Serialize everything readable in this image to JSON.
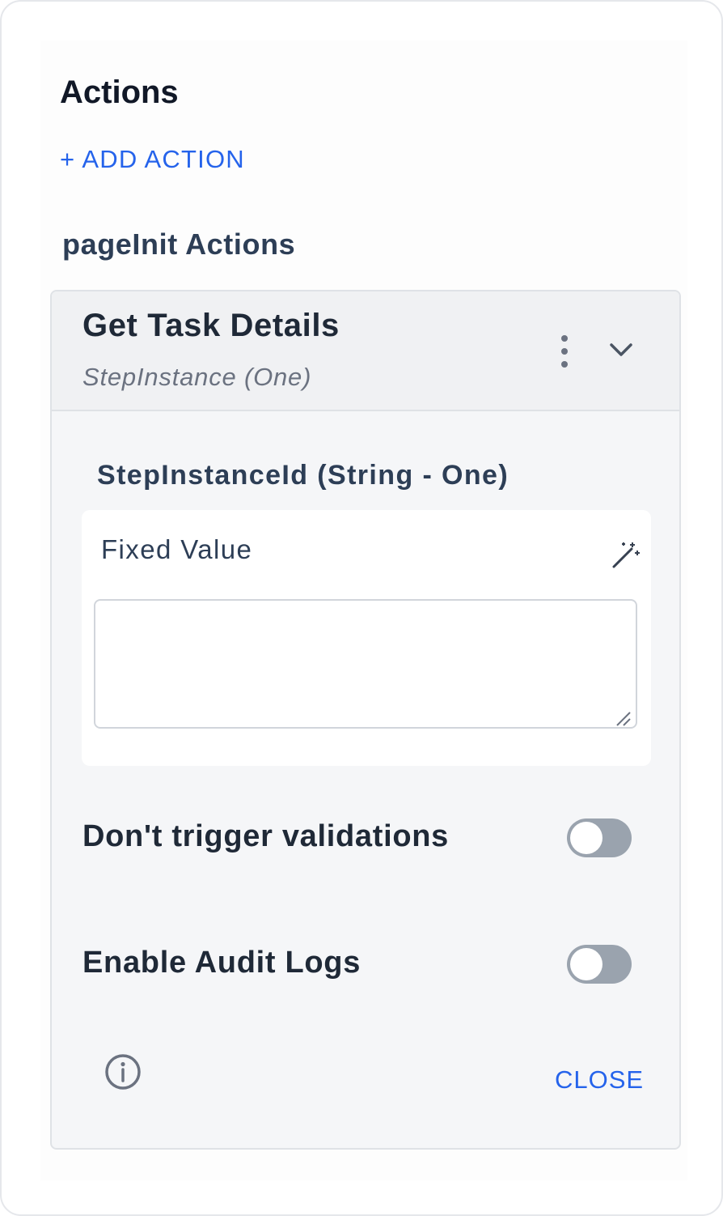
{
  "actions_panel": {
    "title": "Actions",
    "add_action_label": "+ ADD ACTION",
    "group_title": "pageInit Actions"
  },
  "action_card": {
    "title": "Get Task Details",
    "subtitle": "StepInstance (One)",
    "parameter": {
      "label": "StepInstanceId (String - One)",
      "value_mode_label": "Fixed Value",
      "value": ""
    },
    "toggles": [
      {
        "label": "Don't trigger validations",
        "enabled": false
      },
      {
        "label": "Enable Audit Logs",
        "enabled": false
      }
    ],
    "close_label": "CLOSE"
  },
  "icons": {
    "kebab": "more-vertical-icon",
    "chevron": "chevron-down-icon",
    "wand": "magic-wand-icon",
    "info": "info-icon"
  },
  "colors": {
    "accent": "#2563eb",
    "toggle_off": "#9aa3ae",
    "card_bg": "#f5f6f8",
    "header_bg": "#f0f1f3"
  }
}
